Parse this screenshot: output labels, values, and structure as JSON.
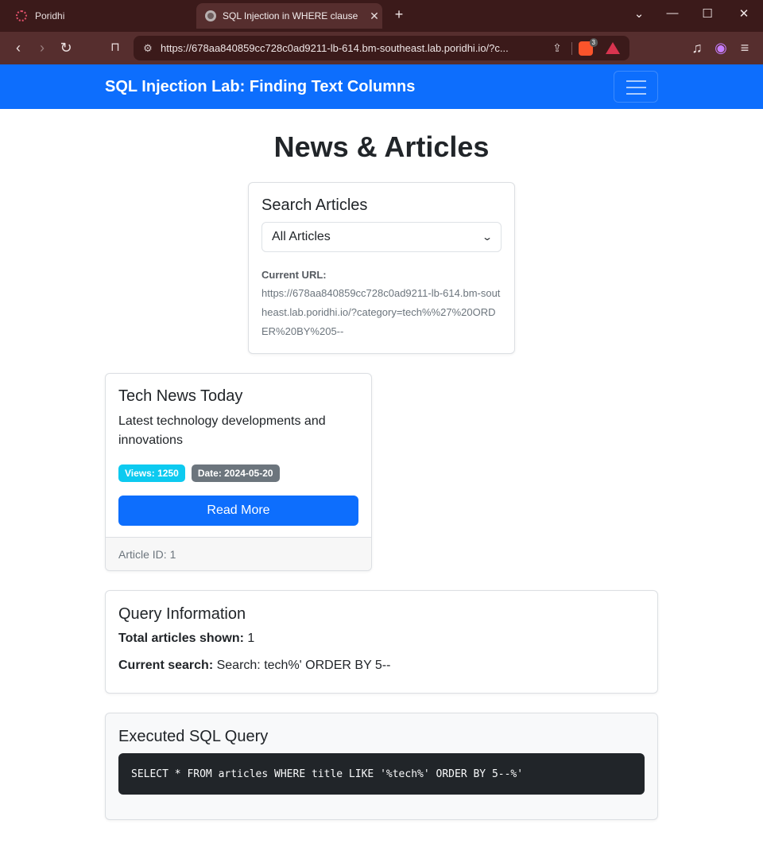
{
  "browser": {
    "tabs": [
      {
        "title": "Poridhi",
        "active": false
      },
      {
        "title": "SQL Injection in WHERE clause",
        "active": true
      }
    ],
    "url": "https://678aa840859cc728c0ad9211-lb-614.bm-southeast.lab.poridhi.io/?c...",
    "brave_shield_count": "3"
  },
  "navbar": {
    "brand": "SQL Injection Lab: Finding Text Columns"
  },
  "page": {
    "title": "News & Articles"
  },
  "search": {
    "heading": "Search Articles",
    "selected_option": "All Articles",
    "current_url_label": "Current URL:",
    "current_url_value": "https://678aa840859cc728c0ad9211-lb-614.bm-southeast.lab.poridhi.io/?category=tech%%27%20ORDER%20BY%205--"
  },
  "articles": [
    {
      "title": "Tech News Today",
      "description": "Latest technology developments and innovations",
      "views_badge": "Views: 1250",
      "date_badge": "Date: 2024-05-20",
      "button_label": "Read More",
      "footer": "Article ID: 1"
    }
  ],
  "query_info": {
    "heading": "Query Information",
    "total_label": "Total articles shown:",
    "total_value": "1",
    "search_label": "Current search:",
    "search_value": "Search: tech%' ORDER BY 5--"
  },
  "sql": {
    "heading": "Executed SQL Query",
    "query": "SELECT * FROM articles WHERE title LIKE '%tech%' ORDER BY 5--%'"
  },
  "colors": {
    "primary": "#0d6efd",
    "info_badge": "#0dcaf0",
    "secondary_badge": "#6c757d",
    "code_bg": "#212529"
  }
}
